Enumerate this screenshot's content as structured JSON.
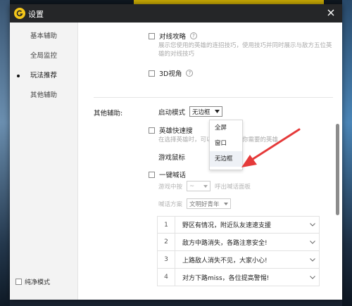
{
  "window": {
    "title": "设置"
  },
  "sidebar": {
    "items": [
      {
        "label": "基本辅助"
      },
      {
        "label": "全局监控"
      },
      {
        "label": "玩法推荐"
      },
      {
        "label": "其他辅助"
      }
    ],
    "pure_mode": "纯净模式"
  },
  "content": {
    "counter": {
      "label": "对线攻略",
      "desc": "展示您使用的英雄的连招技巧，使用技巧并同时展示与敌方五位英雄的对线技巧"
    },
    "view3d": {
      "label": "3D视角"
    },
    "other_section_label": "其他辅助:",
    "launch_mode": {
      "label": "启动模式",
      "value": "无边框",
      "options": [
        "全屏",
        "窗口",
        "无边框"
      ]
    },
    "hero_quick": {
      "label": "英雄快速搜",
      "desc": "在选择英雄时，可以快速搜索到你需要的英雄"
    },
    "mouse": {
      "label": "游戏鼠标"
    },
    "shout": {
      "label": "一键喊话",
      "hotkey_label": "游戏中按",
      "hotkey_value": "~",
      "hotkey_suffix": "呼出喊话面板",
      "scheme_label": "喊话方案",
      "scheme_value": "文明好青年"
    },
    "messages": [
      {
        "n": "1",
        "text": "野区有情况，附近队友速速支援"
      },
      {
        "n": "2",
        "text": "敌方中路消失，各路注意安全!"
      },
      {
        "n": "3",
        "text": "上路敌人消失不见，大家小心!"
      },
      {
        "n": "4",
        "text": "对方下路miss，各位提高警惕!"
      }
    ]
  },
  "colors": {
    "titlebar": "#252628",
    "accent_arrow": "#e53a3a",
    "logo": "#f4c61a"
  }
}
